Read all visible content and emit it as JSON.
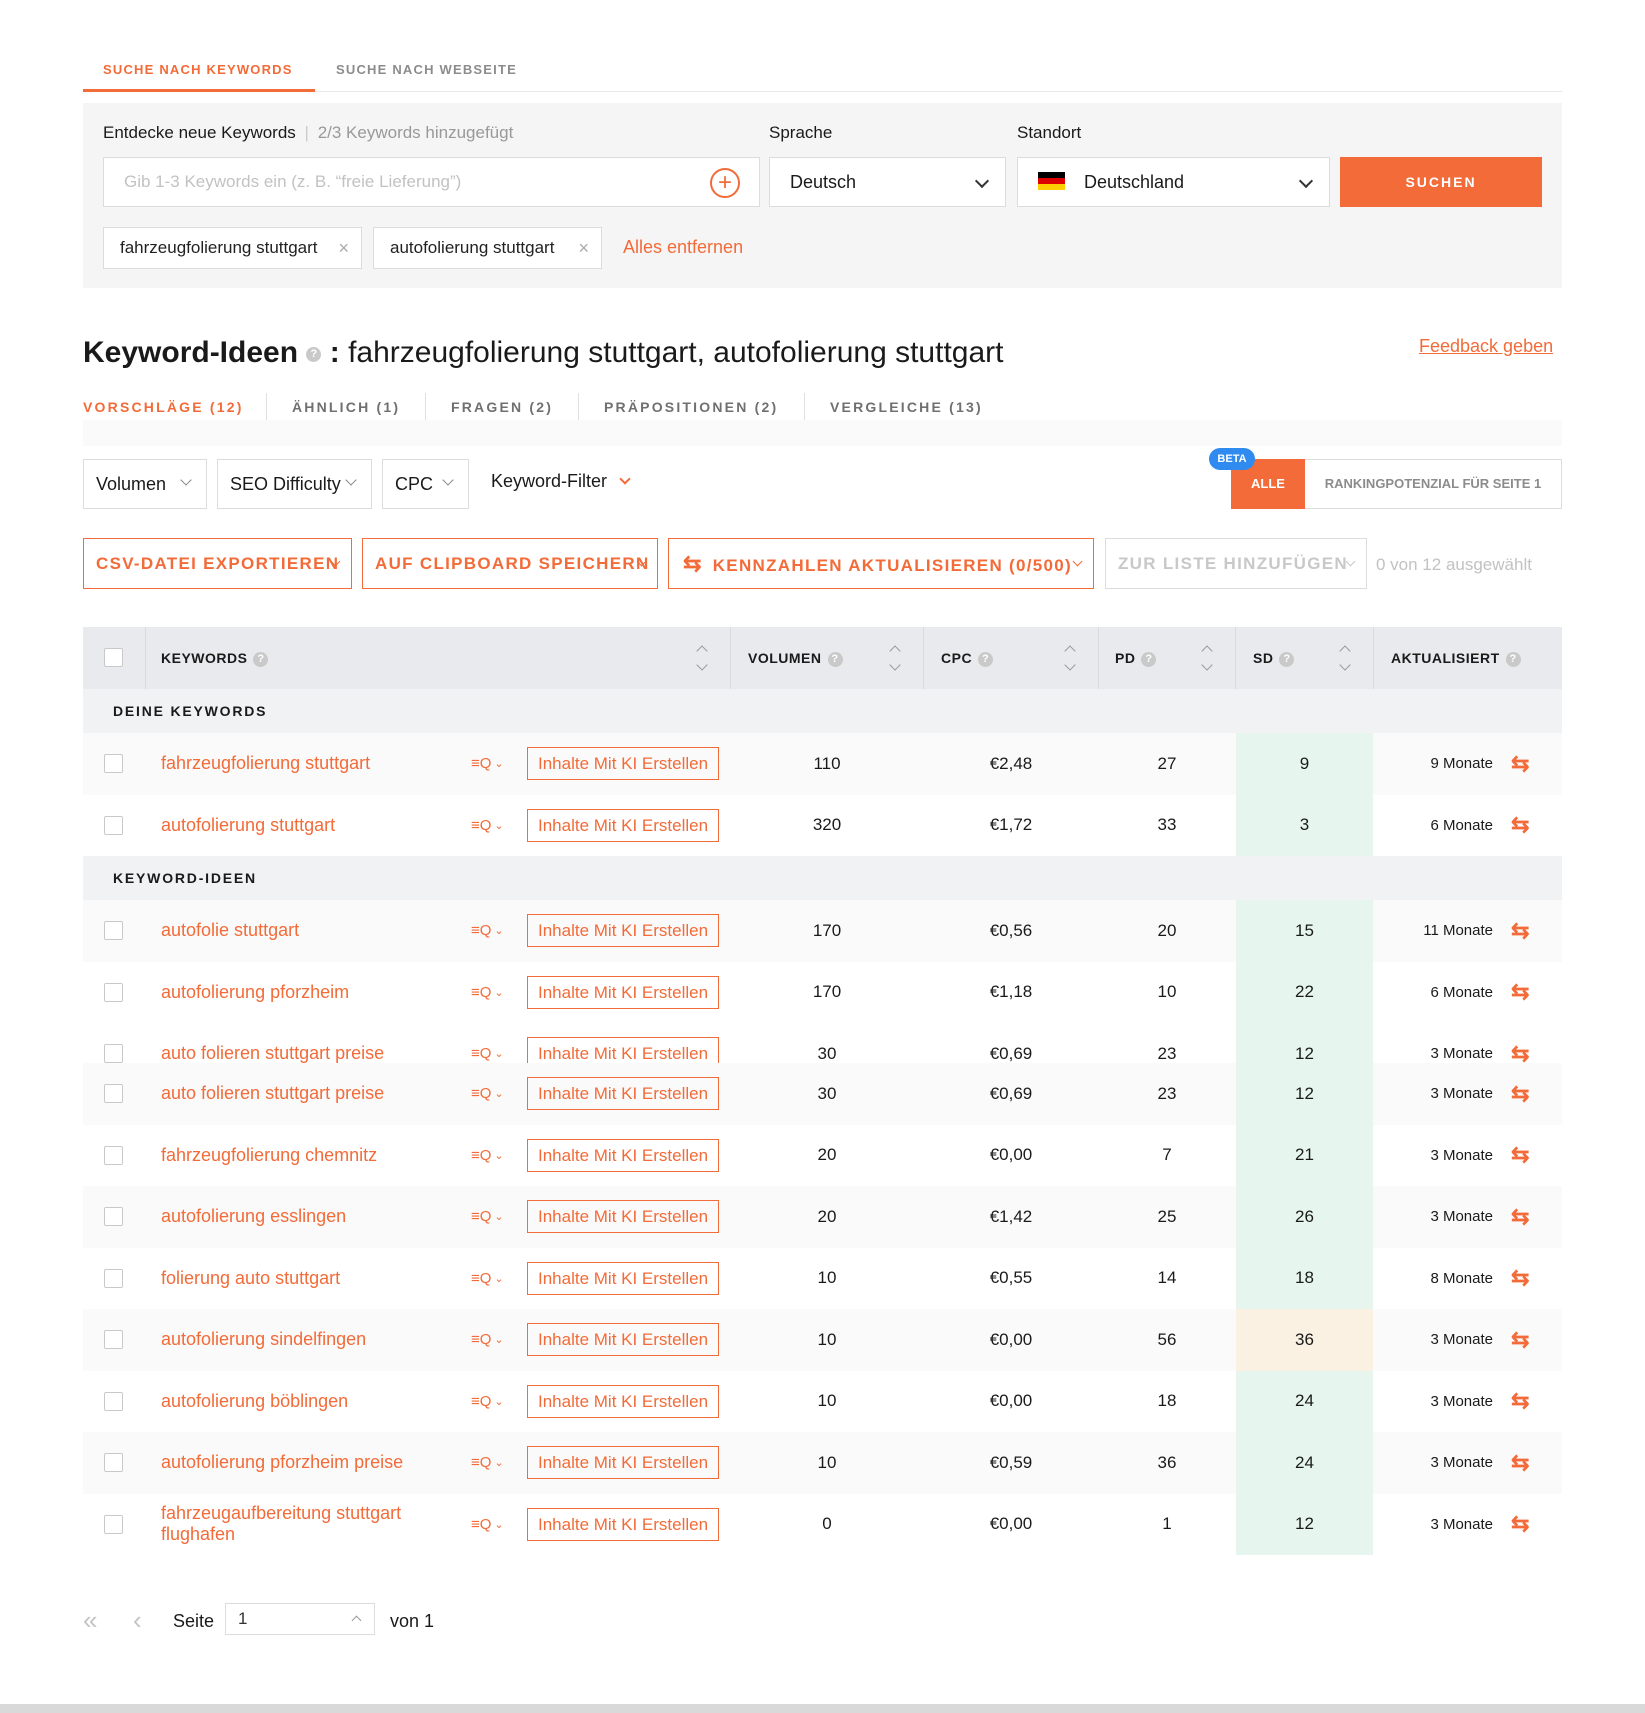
{
  "top_tabs": {
    "by_keywords": "SUCHE NACH KEYWORDS",
    "by_website": "SUCHE NACH WEBSEITE"
  },
  "search": {
    "discover_label": "Entdecke neue Keywords",
    "added_count": "2/3 Keywords hinzugefügt",
    "placeholder": "Gib 1-3 Keywords ein (z. B. “freie Lieferung”)",
    "language_label": "Sprache",
    "language_value": "Deutsch",
    "location_label": "Standort",
    "location_value": "Deutschland",
    "search_button": "SUCHEN",
    "chips": [
      "fahrzeugfolierung stuttgart",
      "autofolierung stuttgart"
    ],
    "remove_all": "Alles entfernen"
  },
  "heading": {
    "title": "Keyword-Ideen",
    "colon": ":",
    "keywords": "fahrzeugfolierung stuttgart, autofolierung stuttgart",
    "feedback": "Feedback geben"
  },
  "sub_tabs": [
    "VORSCHLÄGE (12)",
    "ÄHNLICH (1)",
    "FRAGEN (2)",
    "PRÄPOSITIONEN (2)",
    "VERGLEICHE (13)"
  ],
  "filters": {
    "volume": "Volumen",
    "seo_difficulty": "SEO Difficulty",
    "cpc": "CPC",
    "keyword_filter": "Keyword-Filter",
    "beta": "BETA",
    "all": "ALLE",
    "ranking": "RANKINGPOTENZIAL FÜR SEITE 1"
  },
  "actions": {
    "export_csv": "CSV-DATEI EXPORTIEREN",
    "clipboard": "AUF CLIPBOARD SPEICHERN",
    "refresh_metrics": "KENNZAHLEN AKTUALISIEREN (0/500)",
    "add_to_list": "ZUR LISTE HINZUFÜGEN",
    "selected": "0 von 12 ausgewählt"
  },
  "table": {
    "headers": {
      "keywords": "KEYWORDS",
      "volume": "VOLUMEN",
      "cpc": "CPC",
      "pd": "PD",
      "sd": "SD",
      "updated": "AKTUALISIERT"
    },
    "ai_button": "Inhalte Mit KI Erstellen",
    "section_yours": "DEINE KEYWORDS",
    "section_ideas": "KEYWORD-IDEEN",
    "your_rows": [
      {
        "keyword": "fahrzeugfolierung stuttgart",
        "volume": "110",
        "cpc": "€2,48",
        "pd": "27",
        "sd": "9",
        "updated": "9 Monate"
      },
      {
        "keyword": "autofolierung stuttgart",
        "volume": "320",
        "cpc": "€1,72",
        "pd": "33",
        "sd": "3",
        "updated": "6 Monate"
      }
    ],
    "idea_rows_a": [
      {
        "keyword": "autofolie stuttgart",
        "volume": "170",
        "cpc": "€0,56",
        "pd": "20",
        "sd": "15",
        "updated": "11 Monate"
      },
      {
        "keyword": "autofolierung pforzheim",
        "volume": "170",
        "cpc": "€1,18",
        "pd": "10",
        "sd": "22",
        "updated": "6 Monate"
      }
    ],
    "clipped_row": {
      "keyword": "auto folieren stuttgart preise",
      "volume": "30",
      "cpc": "€0,69",
      "pd": "23",
      "sd": "12",
      "updated": "3 Monate"
    },
    "idea_rows_b": [
      {
        "keyword": "auto folieren stuttgart preise",
        "volume": "30",
        "cpc": "€0,69",
        "pd": "23",
        "sd": "12",
        "updated": "3 Monate"
      },
      {
        "keyword": "fahrzeugfolierung chemnitz",
        "volume": "20",
        "cpc": "€0,00",
        "pd": "7",
        "sd": "21",
        "updated": "3 Monate"
      },
      {
        "keyword": "autofolierung esslingen",
        "volume": "20",
        "cpc": "€1,42",
        "pd": "25",
        "sd": "26",
        "updated": "3 Monate"
      },
      {
        "keyword": "folierung auto stuttgart",
        "volume": "10",
        "cpc": "€0,55",
        "pd": "14",
        "sd": "18",
        "updated": "8 Monate"
      },
      {
        "keyword": "autofolierung sindelfingen",
        "volume": "10",
        "cpc": "€0,00",
        "pd": "56",
        "sd": "36",
        "updated": "3 Monate"
      },
      {
        "keyword": "autofolierung böblingen",
        "volume": "10",
        "cpc": "€0,00",
        "pd": "18",
        "sd": "24",
        "updated": "3 Monate"
      },
      {
        "keyword": "autofolierung pforzheim preise",
        "volume": "10",
        "cpc": "€0,59",
        "pd": "36",
        "sd": "24",
        "updated": "3 Monate"
      },
      {
        "keyword": "fahrzeugaufbereitung stuttgart flughafen",
        "volume": "0",
        "cpc": "€0,00",
        "pd": "1",
        "sd": "12",
        "updated": "3 Monate"
      }
    ]
  },
  "pagination": {
    "page_label": "Seite",
    "page_value": "1",
    "of_label": "von 1"
  },
  "colors": {
    "accent": "#f26b38",
    "sd_easy": "#e6f6ef",
    "sd_medium": "#fbf1e2",
    "beta": "#2f8bf0"
  }
}
